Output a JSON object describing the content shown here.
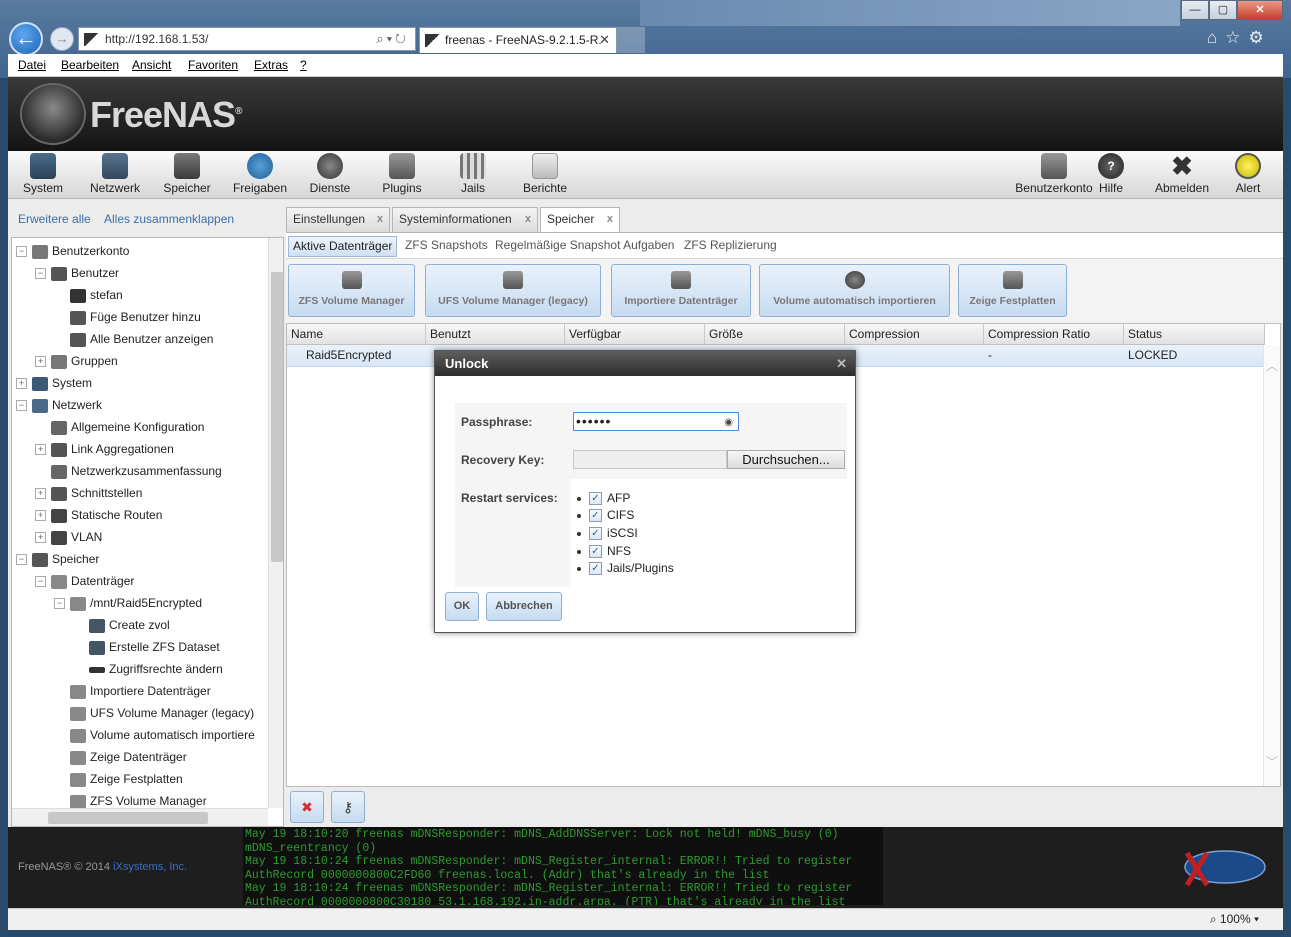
{
  "browser": {
    "address": "http://192.168.1.53/",
    "tab_title": "freenas - FreeNAS-9.2.1.5-R...",
    "menu": [
      "Datei",
      "Bearbeiten",
      "Ansicht",
      "Favoriten",
      "Extras",
      "?"
    ],
    "zoom": "100%"
  },
  "app": {
    "logo": "FreeNAS",
    "toolbar": [
      "System",
      "Netzwerk",
      "Speicher",
      "Freigaben",
      "Dienste",
      "Plugins",
      "Jails",
      "Berichte"
    ],
    "toolbar_right": [
      "Benutzerkonto",
      "Hilfe",
      "Abmelden",
      "Alert"
    ],
    "expand_all": "Erweitere alle",
    "collapse_all": "Alles zusammenklappen"
  },
  "tree": [
    {
      "label": "Benutzerkonto",
      "icon": "user-group-icon"
    },
    {
      "label": "Benutzer",
      "icon": "user-icon"
    },
    {
      "label": "stefan",
      "icon": "user-icon"
    },
    {
      "label": "Füge Benutzer hinzu",
      "icon": "user-add-icon"
    },
    {
      "label": "Alle Benutzer anzeigen",
      "icon": "user-list-icon"
    },
    {
      "label": "Gruppen",
      "icon": "group-icon"
    },
    {
      "label": "System",
      "icon": "system-icon"
    },
    {
      "label": "Netzwerk",
      "icon": "network-icon"
    },
    {
      "label": "Allgemeine Konfiguration",
      "icon": "wrench-icon"
    },
    {
      "label": "Link Aggregationen",
      "icon": "link-icon"
    },
    {
      "label": "Netzwerkzusammenfassung",
      "icon": "wrench-icon"
    },
    {
      "label": "Schnittstellen",
      "icon": "interface-icon"
    },
    {
      "label": "Statische Routen",
      "icon": "route-icon"
    },
    {
      "label": "VLAN",
      "icon": "vlan-icon"
    },
    {
      "label": "Speicher",
      "icon": "storage-icon"
    },
    {
      "label": "Datenträger",
      "icon": "disk-icon"
    },
    {
      "label": "/mnt/Raid5Encrypted",
      "icon": "disk-icon"
    },
    {
      "label": "Create zvol",
      "icon": "table-icon"
    },
    {
      "label": "Erstelle ZFS Dataset",
      "icon": "table-icon"
    },
    {
      "label": "Zugriffsrechte ändern",
      "icon": "key-icon"
    },
    {
      "label": "Importiere Datenträger",
      "icon": "import-icon"
    },
    {
      "label": "UFS Volume Manager (legacy)",
      "icon": "volume-icon"
    },
    {
      "label": "Volume automatisch importiere",
      "icon": "import-icon"
    },
    {
      "label": "Zeige Datenträger",
      "icon": "disk-icon"
    },
    {
      "label": "Zeige Festplatten",
      "icon": "disk-icon"
    },
    {
      "label": "ZFS Volume Manager",
      "icon": "volume-icon"
    }
  ],
  "tabs": [
    "Einstellungen",
    "Systeminformationen",
    "Speicher"
  ],
  "subtabs": [
    "Aktive Datenträger",
    "ZFS Snapshots",
    "Regelmäßige Snapshot Aufgaben",
    "ZFS Replizierung"
  ],
  "actions": [
    "ZFS Volume Manager",
    "UFS Volume Manager (legacy)",
    "Importiere Datenträger",
    "Volume automatisch importieren",
    "Zeige Festplatten"
  ],
  "grid": {
    "columns": [
      "Name",
      "Benutzt",
      "Verfügbar",
      "Größe",
      "Compression",
      "Compression Ratio",
      "Status"
    ],
    "row": {
      "name": "Raid5Encrypted",
      "ratio": "-",
      "status": "LOCKED"
    }
  },
  "dialog": {
    "title": "Unlock",
    "passphrase_label": "Passphrase:",
    "passphrase_value": "••••••",
    "recovery_label": "Recovery Key:",
    "browse": "Durchsuchen...",
    "restart_label": "Restart services:",
    "services": [
      "AFP",
      "CIFS",
      "iSCSI",
      "NFS",
      "Jails/Plugins"
    ],
    "ok": "OK",
    "cancel": "Abbrechen"
  },
  "footer": {
    "copyright": "FreeNAS® © 2014 ",
    "company": "iXsystems, Inc.",
    "console": "May 19 18:10:20 freenas mDNSResponder: mDNS_AddDNSServer: Lock not held! mDNS_busy (0)\nmDNS_reentrancy (0)\nMay 19 18:10:24 freenas mDNSResponder: mDNS_Register_internal: ERROR!! Tried to register\nAuthRecord 0000000800C2FD60 freenas.local. (Addr) that's already in the list\nMay 19 18:10:24 freenas mDNSResponder: mDNS_Register_internal: ERROR!! Tried to register\nAuthRecord 0000000800C30180 53.1.168.192.in-addr.arpa. (PTR) that's already in the list"
  },
  "colors": {
    "accent": "#3c6fa8",
    "title_dark": "#2c2c2c",
    "console_green": "#2d9c2d"
  }
}
